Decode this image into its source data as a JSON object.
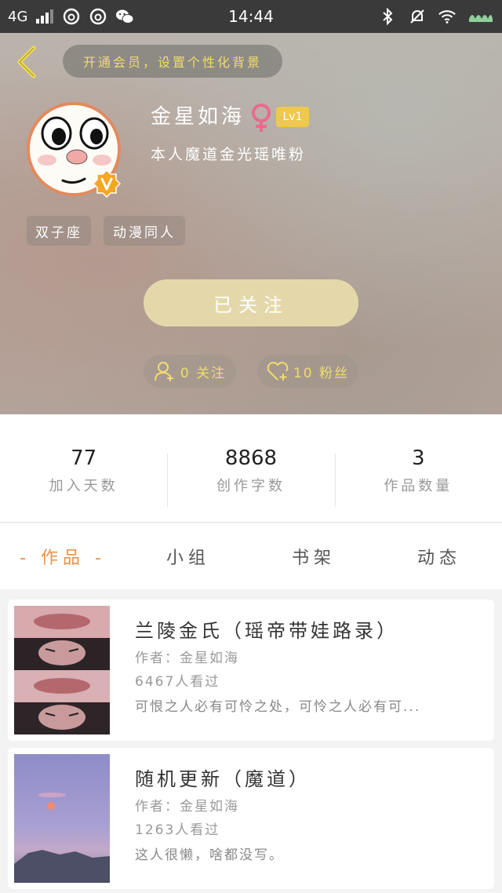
{
  "status_bar": {
    "network": "4G",
    "time": "14:44"
  },
  "header": {
    "vip_banner": "开通会员，设置个性化背景",
    "nickname": "金星如海",
    "level": "Lv1",
    "bio": "本人魔道金光瑶唯粉",
    "tags": [
      "双子座",
      "动漫同人"
    ],
    "follow_button": "已关注",
    "following": "0 关注",
    "followers": "10 粉丝"
  },
  "stats": [
    {
      "value": "77",
      "label": "加入天数"
    },
    {
      "value": "8868",
      "label": "创作字数"
    },
    {
      "value": "3",
      "label": "作品数量"
    }
  ],
  "tabs": [
    "- 作品 -",
    "小组",
    "书架",
    "动态"
  ],
  "works": [
    {
      "title": "兰陵金氏（瑶帝带娃路录）",
      "author": "作者：金星如海",
      "views": "6467人看过",
      "desc": "可恨之人必有可怜之处，可怜之人必有可..."
    },
    {
      "title": "随机更新（魔道）",
      "author": "作者：金星如海",
      "views": "1263人看过",
      "desc": "这人很懒，啥都没写。"
    }
  ],
  "colors": {
    "accent": "#e7934a",
    "vip_text": "#f1dd6b",
    "level_badge": "#f0c84e",
    "follow_button": "#e4d8aa"
  }
}
